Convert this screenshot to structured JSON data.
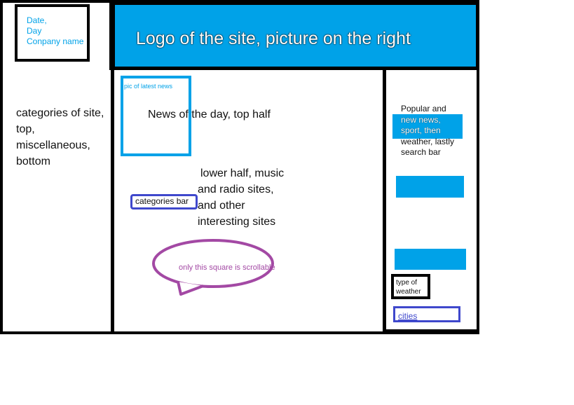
{
  "date_box": {
    "line1": "Date,",
    "line2": "Day",
    "line3": "Conpany name"
  },
  "header": {
    "title": "Logo of the site, picture on the right"
  },
  "left_panel": {
    "line1": "categories of site,",
    "line2": "top,",
    "line3": "miscellaneous,",
    "line4": "bottom"
  },
  "center_panel": {
    "pic_label": "pic of latest news",
    "news_text": "News of the day, top half",
    "lower_line1": "lower half, music",
    "lower_line2": "and radio sites,",
    "lower_line3": "and other",
    "lower_line4": "interesting sites",
    "categories_bar": "categories bar",
    "scroll_note": "only this square is scrollable"
  },
  "right_panel": {
    "line1": "Popular and",
    "line2": "new news,",
    "line3": "sport, then",
    "line4": "weather, lastly",
    "line5": "search bar",
    "weather_line1": "type of",
    "weather_line2": "weather",
    "cities": "cities"
  },
  "colors": {
    "blue": "#00a2e8",
    "black": "#000000",
    "indigo": "#3f48cc",
    "purple": "#a349a4"
  }
}
